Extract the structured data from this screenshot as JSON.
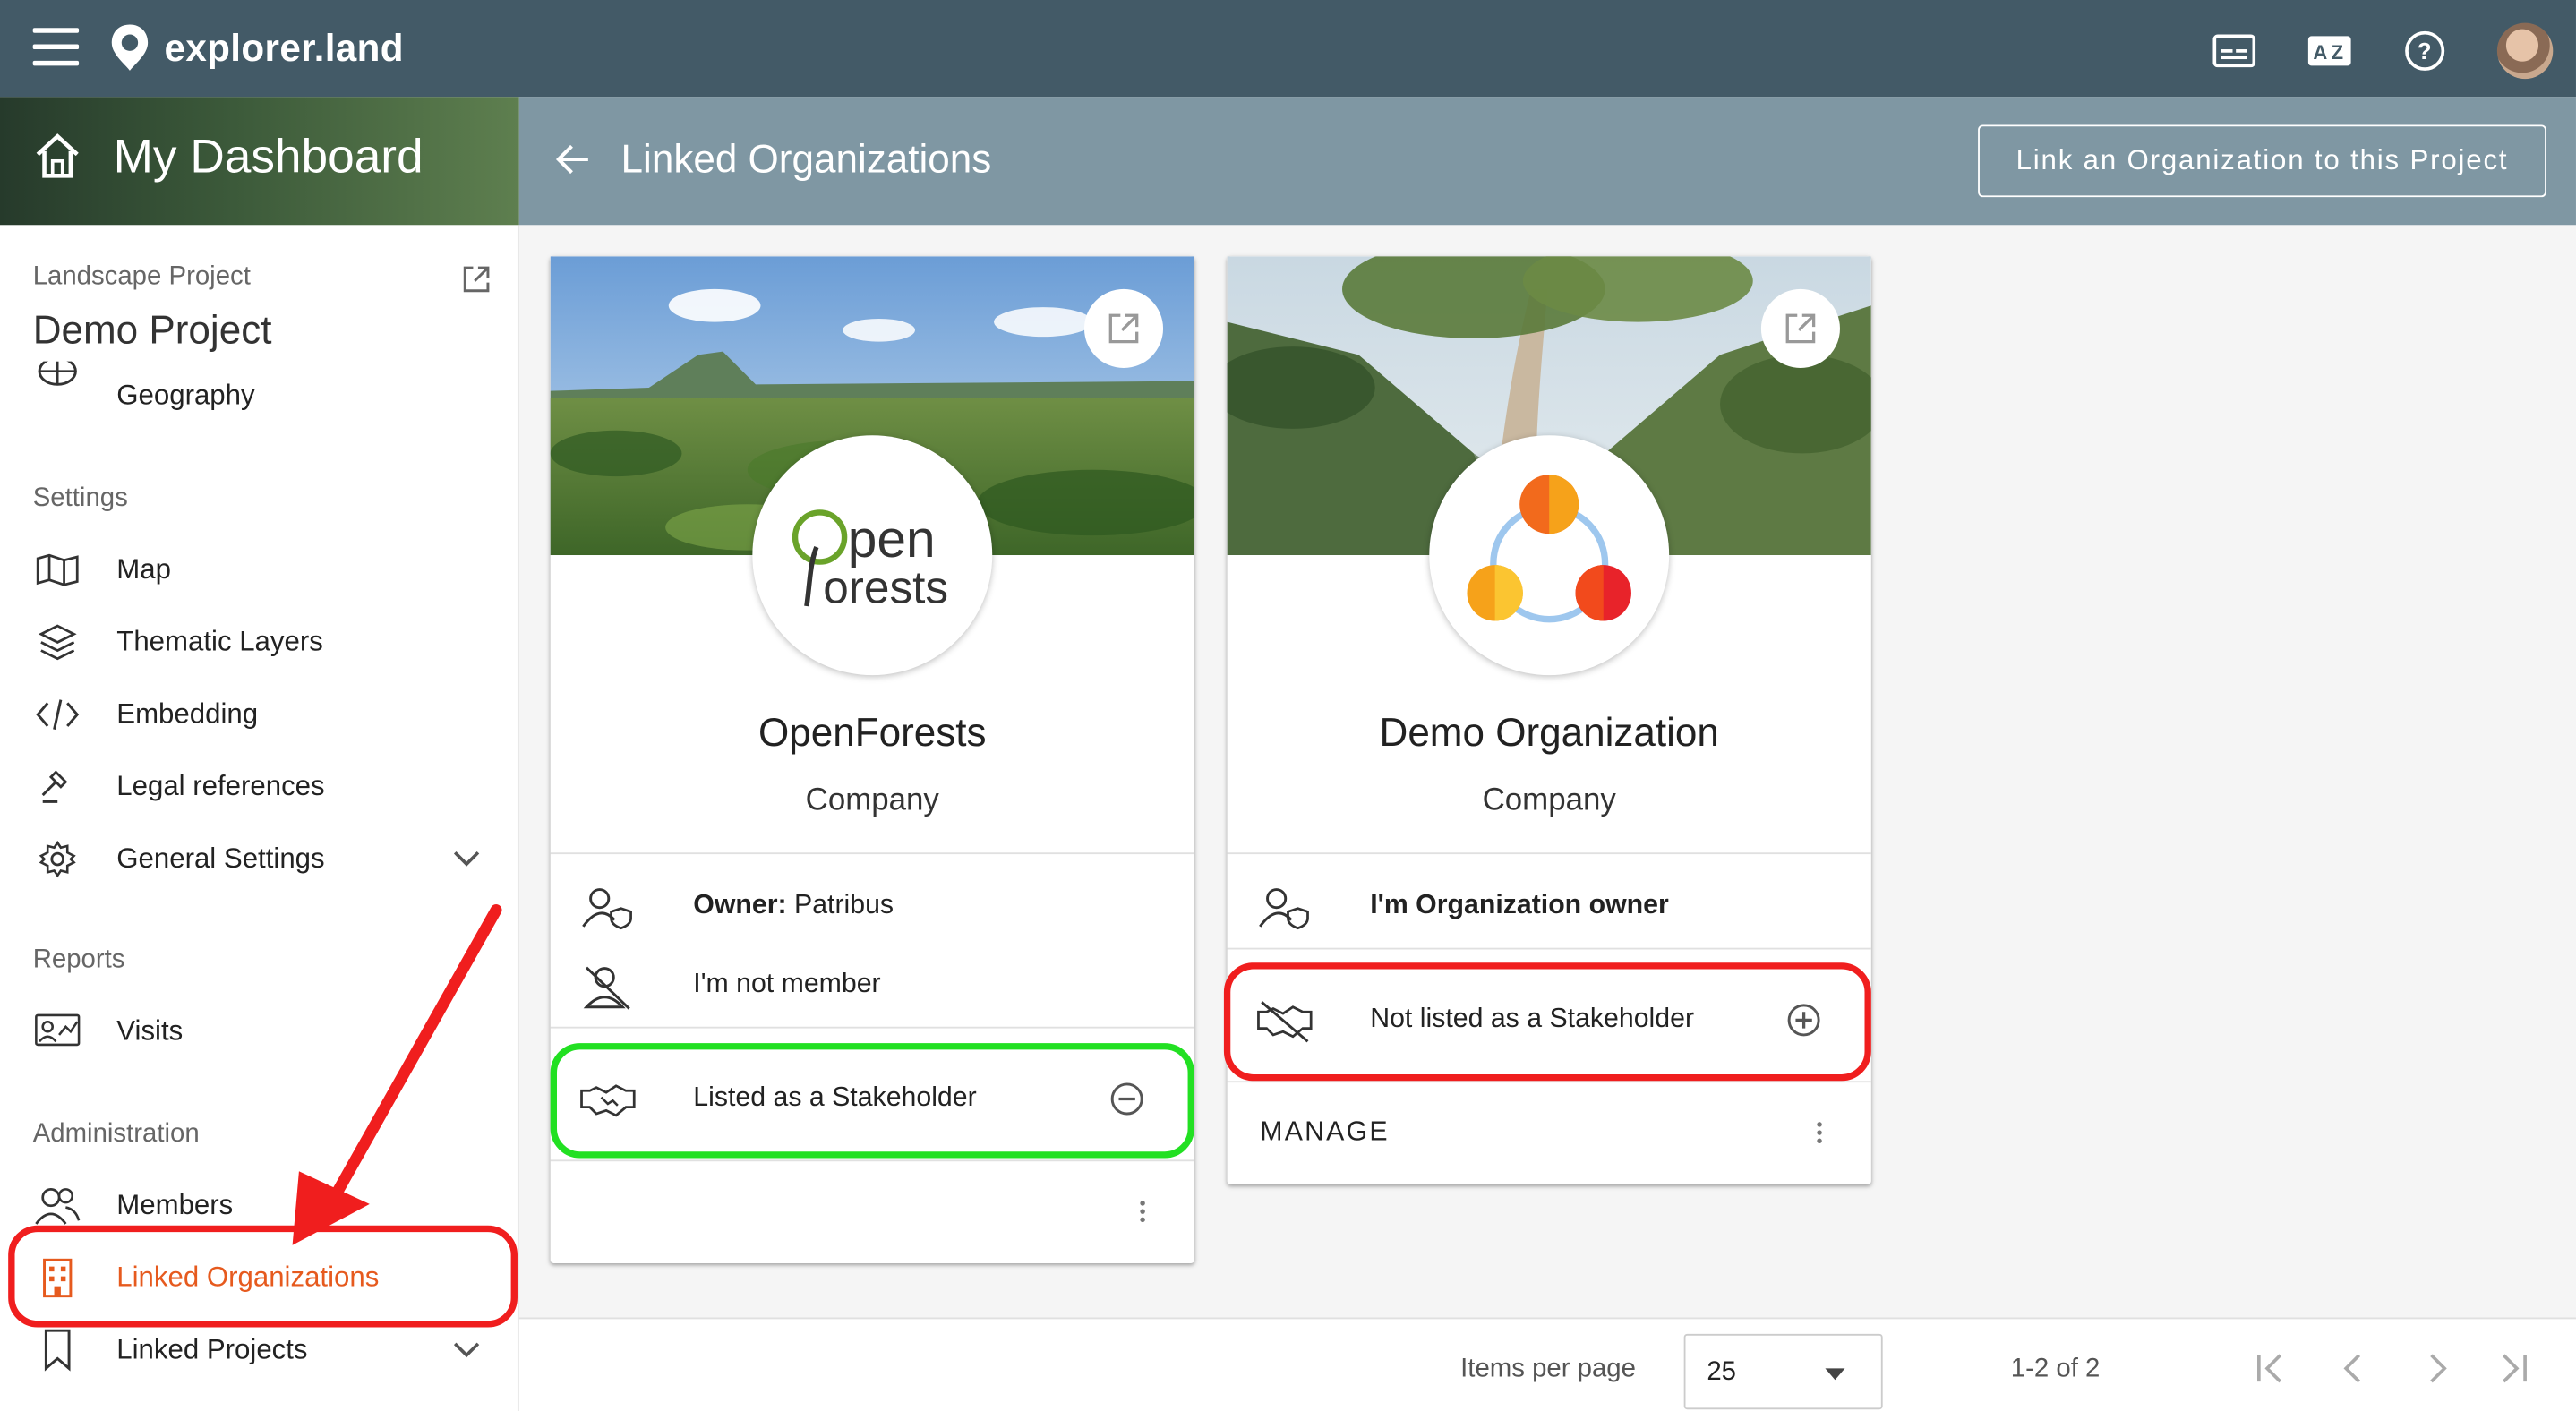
{
  "topbar": {
    "brand": "explorer.land",
    "icons": [
      "subtitles-icon",
      "translate-icon",
      "help-icon",
      "user-avatar"
    ]
  },
  "sidebar": {
    "header_title": "My Dashboard",
    "project_kind": "Landscape Project",
    "project_name": "Demo Project",
    "partial_item": "Geography",
    "sections": {
      "settings": "Settings",
      "reports": "Reports",
      "administration": "Administration"
    },
    "settings_items": [
      {
        "label": "Map",
        "icon": "map-icon"
      },
      {
        "label": "Thematic Layers",
        "icon": "layers-icon"
      },
      {
        "label": "Embedding",
        "icon": "code-icon"
      },
      {
        "label": "Legal references",
        "icon": "gavel-icon"
      },
      {
        "label": "General Settings",
        "icon": "gear-icon"
      }
    ],
    "reports_items": [
      {
        "label": "Visits",
        "icon": "visits-icon"
      }
    ],
    "admin_items": [
      {
        "label": "Members",
        "icon": "members-icon"
      },
      {
        "label": "Linked Organizations",
        "icon": "building-icon",
        "active": true
      },
      {
        "label": "Linked Projects",
        "icon": "bookmark-icon"
      }
    ]
  },
  "content": {
    "title": "Linked Organizations",
    "link_button": "Link an Organization to this Project"
  },
  "cards": [
    {
      "name": "OpenForests",
      "type": "Company",
      "logo_text_top": "pen",
      "logo_text_bottom": "orests",
      "owner_label": "Owner:",
      "owner_name": "Patribus",
      "membership": "I'm not member",
      "stakeholder": "Listed as a Stakeholder"
    },
    {
      "name": "Demo Organization",
      "type": "Company",
      "owner_text": "I'm Organization owner",
      "stakeholder": "Not listed as a Stakeholder",
      "manage": "MANAGE"
    }
  ],
  "paginator": {
    "items_per_page_label": "Items per page",
    "items_per_page_value": "25",
    "range": "1-2 of 2"
  },
  "colors": {
    "topbar": "#435a67",
    "header": "#7f97a3",
    "active": "#e65a1e",
    "highlight_green": "#22e022",
    "highlight_red": "#f01e1e"
  }
}
